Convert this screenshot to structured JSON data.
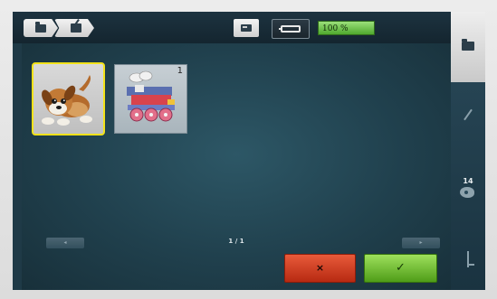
{
  "topbar": {
    "breadcrumb": [
      {
        "icon": "folder-icon"
      },
      {
        "icon": "export-icon"
      }
    ],
    "mode_buttons": [
      {
        "icon": "sewing-machine-icon",
        "active": false
      },
      {
        "icon": "embroidery-hoop-icon",
        "active": true
      }
    ],
    "zoom_label": "100 %"
  },
  "sidebar": {
    "items": [
      {
        "icon": "folder-icon",
        "active": true
      },
      {
        "icon": "pencil-icon",
        "active": false
      },
      {
        "icon": "color-palette-icon",
        "active": false,
        "count": "14"
      },
      {
        "icon": "needle-icon",
        "active": false
      }
    ]
  },
  "designs": [
    {
      "name": "puppy-design",
      "selected": true,
      "number": ""
    },
    {
      "name": "train-design",
      "selected": false,
      "number": "1"
    }
  ],
  "pagination": {
    "indicator": "1 / 1",
    "prev_glyph": "◂",
    "next_glyph": "▸"
  },
  "actions": {
    "cancel_glyph": "×",
    "confirm_glyph": "✓"
  },
  "colors": {
    "selection_border": "#f2e21a",
    "zoom_green": "#4fa82e",
    "cancel_red": "#c73a1c",
    "confirm_green": "#62b226"
  }
}
